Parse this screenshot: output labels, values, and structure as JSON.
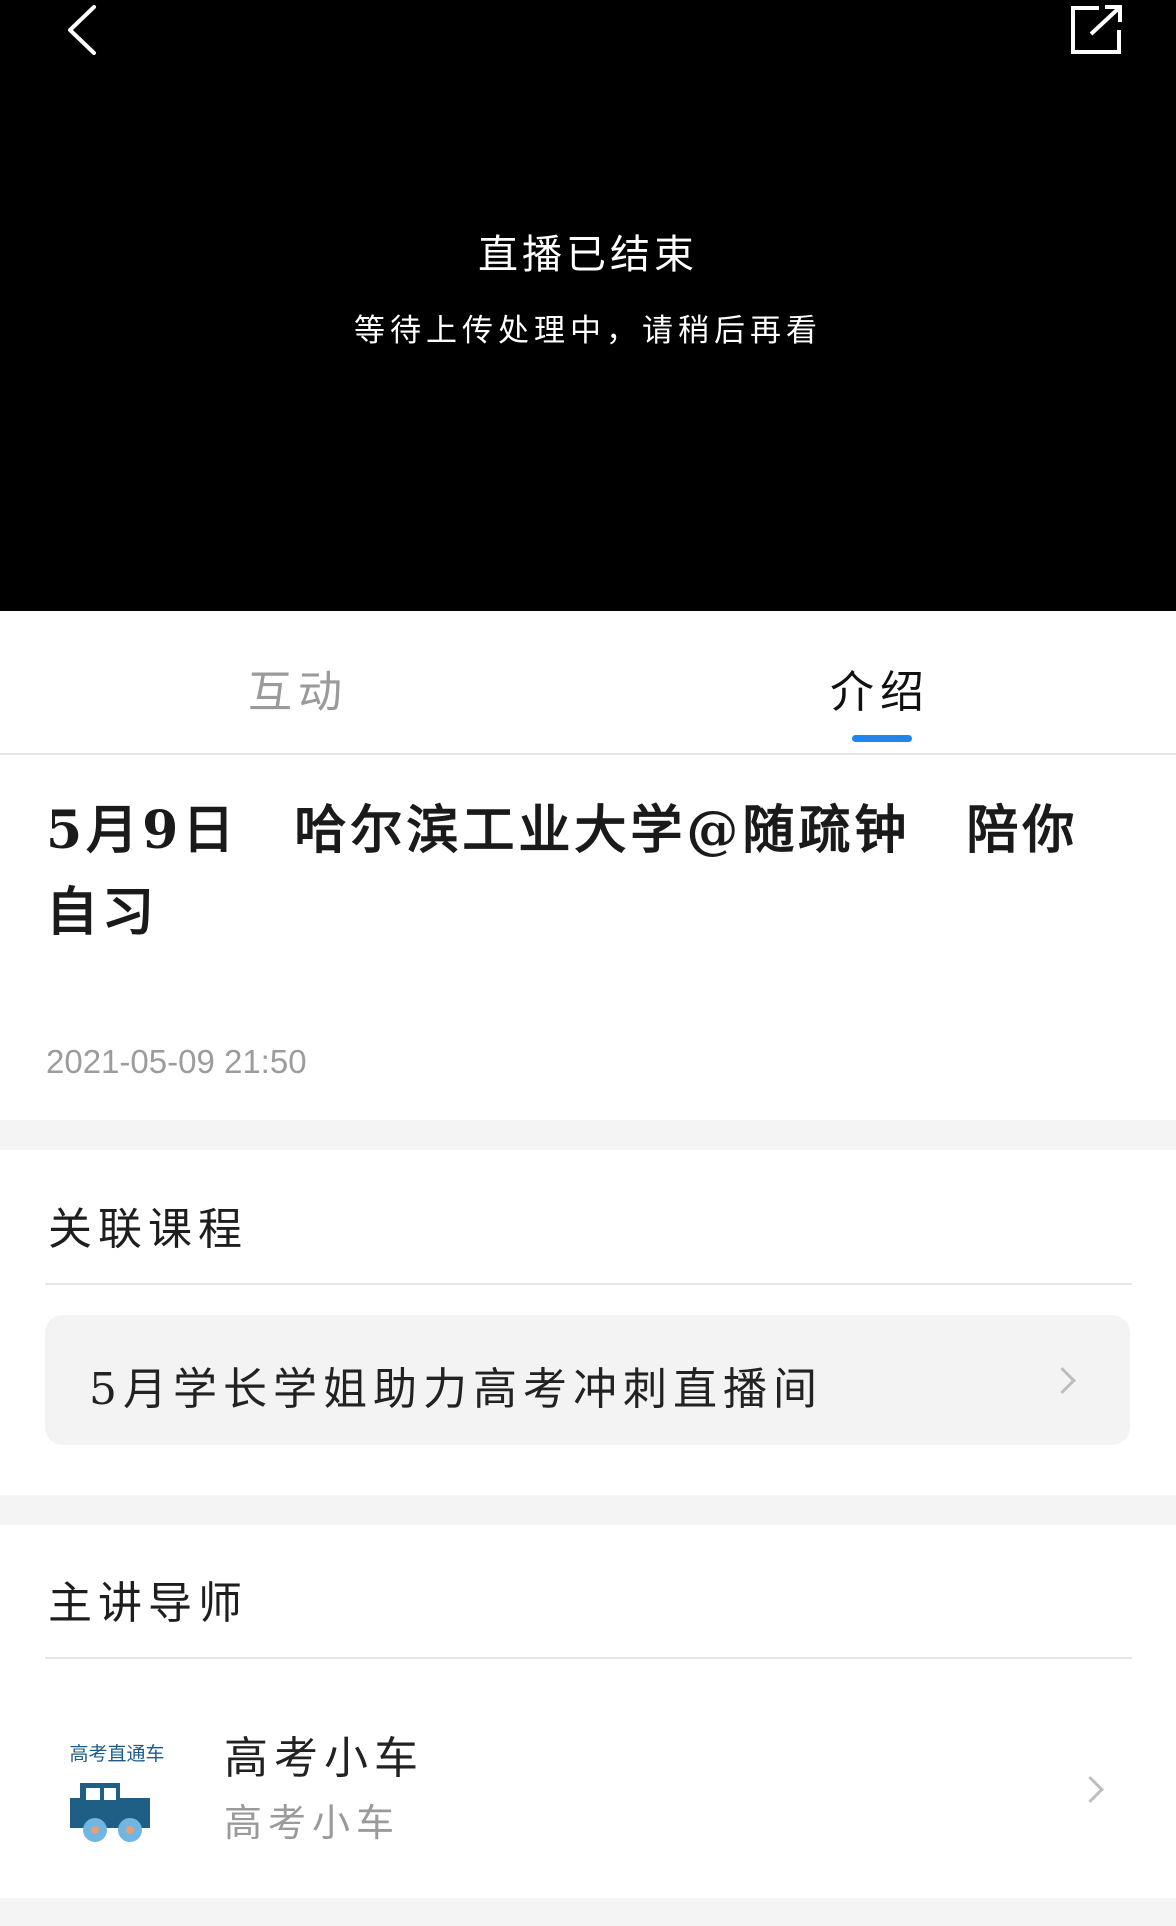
{
  "video": {
    "status_title": "直播已结束",
    "status_subtitle": "等待上传处理中，请稍后再看"
  },
  "tabs": [
    {
      "label": "互动",
      "active": false
    },
    {
      "label": "介绍",
      "active": true
    }
  ],
  "accent_color": "#1f86f0",
  "intro": {
    "title": "5月9日　哈尔滨工业大学@随疏钟　陪你自习",
    "datetime": "2021-05-09  21:50"
  },
  "related_course": {
    "heading": "关联课程",
    "course_name": "5月学长学姐助力高考冲刺直播间"
  },
  "teacher": {
    "heading": "主讲导师",
    "name": "高考小车",
    "subtitle": "高考小车",
    "avatar_text": "高考直通车"
  },
  "icons": {
    "back": "chevron-left-icon",
    "share": "share-external-icon",
    "chevron": "chevron-right-icon"
  }
}
